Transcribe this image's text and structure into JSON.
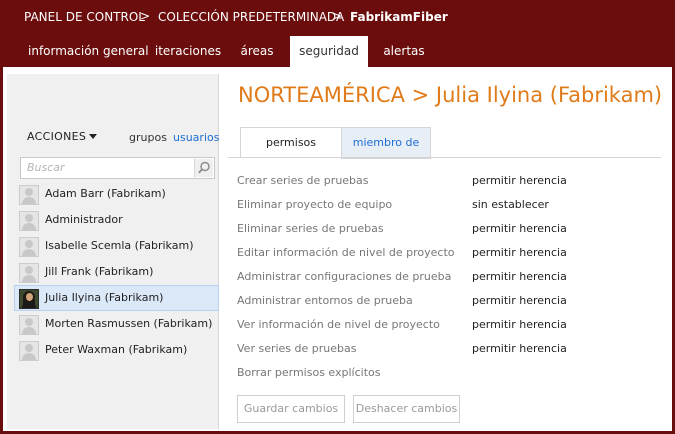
{
  "breadcrumb": {
    "items": [
      "PANEL DE CONTROL",
      "COLECCIÓN PREDETERMINADA",
      "FabrikamFiber"
    ],
    "separator": ">"
  },
  "tabs": [
    {
      "label": "información general"
    },
    {
      "label": "iteraciones"
    },
    {
      "label": "áreas"
    },
    {
      "label": "seguridad",
      "active": true
    },
    {
      "label": "alertas"
    }
  ],
  "left_panel": {
    "actions_label": "ACCIONES",
    "groups_link": "grupos",
    "users_link": "usuarios",
    "search_placeholder": "Buscar",
    "users": [
      {
        "name": "Adam Barr (Fabrikam)"
      },
      {
        "name": "Administrador"
      },
      {
        "name": "Isabelle Scemla (Fabrikam)"
      },
      {
        "name": "Jill Frank (Fabrikam)"
      },
      {
        "name": "Julia Ilyina (Fabrikam)",
        "selected": true
      },
      {
        "name": "Morten Rasmussen (Fabrikam)"
      },
      {
        "name": "Peter Waxman (Fabrikam)"
      }
    ]
  },
  "main": {
    "title": "NORTEAMÉRICA  >  Julia Ilyina (Fabrikam)",
    "tabs": [
      {
        "label": "permisos"
      },
      {
        "label": "miembro de"
      }
    ],
    "permissions": [
      {
        "name": "Crear series de pruebas",
        "value": "permitir herencia"
      },
      {
        "name": "Eliminar proyecto de equipo",
        "value": "sin establecer"
      },
      {
        "name": "Eliminar series de pruebas",
        "value": "permitir herencia"
      },
      {
        "name": "Editar información de nivel de proyecto",
        "value": "permitir herencia"
      },
      {
        "name": "Administrar configuraciones de prueba",
        "value": "permitir herencia"
      },
      {
        "name": "Administrar entornos de prueba",
        "value": "permitir herencia"
      },
      {
        "name": "Ver información de nivel de proyecto",
        "value": "permitir herencia"
      },
      {
        "name": "Ver series de pruebas",
        "value": "permitir herencia"
      }
    ],
    "clear_link": "Borrar permisos explícitos",
    "save_button": "Guardar cambios",
    "undo_button": "Deshacer cambios"
  },
  "colors": {
    "header_bg": "#6b0d0d",
    "title": "#e07b1a",
    "link": "#1c6ed4",
    "selection": "#dbe8f7"
  }
}
